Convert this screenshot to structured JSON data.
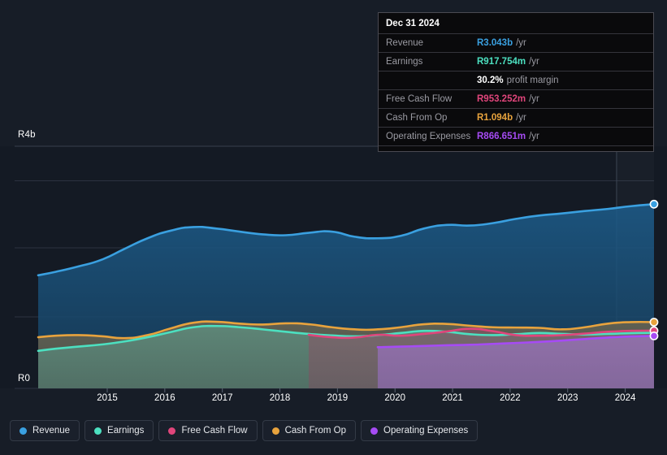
{
  "theme": {
    "background": "#171d27",
    "plot_background": "#141a24",
    "gridline": "#2b3240"
  },
  "tooltip": {
    "date": "Dec 31 2024",
    "rows": [
      {
        "name": "Revenue",
        "value": "R3.043b",
        "unit": "/yr",
        "color": "#3aa0e0"
      },
      {
        "name": "Earnings",
        "value": "R917.754m",
        "unit": "/yr",
        "color": "#4ce0c0"
      },
      {
        "name": "",
        "value": "30.2%",
        "unit": "",
        "sub": "profit margin",
        "color": "#ffffff"
      },
      {
        "name": "Free Cash Flow",
        "value": "R953.252m",
        "unit": "/yr",
        "color": "#e0457b"
      },
      {
        "name": "Cash From Op",
        "value": "R1.094b",
        "unit": "/yr",
        "color": "#e8a33d"
      },
      {
        "name": "Operating Expenses",
        "value": "R866.651m",
        "unit": "/yr",
        "color": "#a64bf4"
      }
    ]
  },
  "legend": {
    "items": [
      {
        "label": "Revenue",
        "color": "#3aa0e0"
      },
      {
        "label": "Earnings",
        "color": "#4ce0c0"
      },
      {
        "label": "Free Cash Flow",
        "color": "#e0457b"
      },
      {
        "label": "Cash From Op",
        "color": "#e8a33d"
      },
      {
        "label": "Operating Expenses",
        "color": "#a64bf4"
      }
    ]
  },
  "chart_data": {
    "type": "area",
    "title": "",
    "xlabel": "",
    "ylabel": "",
    "currency": "R",
    "ylim": [
      0,
      4000000000
    ],
    "y_ticks": [
      {
        "label": "R0",
        "value": 0
      },
      {
        "label": "R4b",
        "value": 4000000000
      }
    ],
    "grid": true,
    "legend_position": "bottom",
    "x_ticks": [
      "2015",
      "2016",
      "2017",
      "2018",
      "2019",
      "2020",
      "2021",
      "2022",
      "2023",
      "2024"
    ],
    "x": [
      2014.3,
      2014.6,
      2015.0,
      2015.4,
      2015.8,
      2016.2,
      2016.6,
      2017.0,
      2017.4,
      2017.8,
      2018.2,
      2018.6,
      2019.0,
      2019.4,
      2019.8,
      2020.2,
      2020.6,
      2021.0,
      2021.4,
      2021.8,
      2022.2,
      2022.6,
      2023.0,
      2023.4,
      2023.8,
      2024.2,
      2024.6,
      2025.0
    ],
    "series": [
      {
        "name": "Revenue",
        "color": "#3aa0e0",
        "values": [
          1.868,
          1.925,
          2.015,
          2.125,
          2.305,
          2.48,
          2.605,
          2.665,
          2.64,
          2.59,
          2.545,
          2.53,
          2.57,
          2.59,
          2.505,
          2.48,
          2.52,
          2.64,
          2.7,
          2.69,
          2.73,
          2.8,
          2.855,
          2.89,
          2.93,
          2.965,
          3.01,
          3.043
        ],
        "unit": "R (billions)"
      },
      {
        "name": "Cash From Op",
        "color": "#e8a33d",
        "values": [
          0.845,
          0.87,
          0.88,
          0.862,
          0.83,
          0.88,
          0.99,
          1.085,
          1.1,
          1.07,
          1.055,
          1.075,
          1.06,
          1.01,
          0.975,
          0.975,
          1.01,
          1.06,
          1.065,
          1.035,
          1.01,
          1.005,
          1.0,
          0.975,
          1.01,
          1.07,
          1.095,
          1.094
        ],
        "unit": "R (billions)"
      },
      {
        "name": "Earnings",
        "color": "#4ce0c0",
        "values": [
          0.62,
          0.655,
          0.69,
          0.725,
          0.775,
          0.845,
          0.93,
          1.01,
          1.03,
          1.01,
          0.975,
          0.935,
          0.9,
          0.875,
          0.86,
          0.88,
          0.915,
          0.95,
          0.935,
          0.895,
          0.88,
          0.895,
          0.915,
          0.9,
          0.89,
          0.9,
          0.912,
          0.918
        ],
        "unit": "R (billions)"
      },
      {
        "name": "Free Cash Flow",
        "color": "#e0457b",
        "start_index": 12,
        "values": [
          null,
          null,
          null,
          null,
          null,
          null,
          null,
          null,
          null,
          null,
          null,
          null,
          0.885,
          0.845,
          0.84,
          0.885,
          0.87,
          0.9,
          0.94,
          0.985,
          0.945,
          0.88,
          0.87,
          0.88,
          0.905,
          0.935,
          0.95,
          0.953
        ],
        "unit": "R (billions)"
      },
      {
        "name": "Operating Expenses",
        "color": "#a64bf4",
        "start_index": 15,
        "values": [
          null,
          null,
          null,
          null,
          null,
          null,
          null,
          null,
          null,
          null,
          null,
          null,
          null,
          null,
          null,
          0.68,
          0.69,
          0.7,
          0.712,
          0.72,
          0.735,
          0.75,
          0.768,
          0.79,
          0.815,
          0.84,
          0.858,
          0.867
        ],
        "unit": "R (billions)"
      }
    ],
    "forecast_divider_x": 2024.35,
    "end_markers": [
      {
        "series": "Revenue",
        "value": 3.043
      },
      {
        "series": "Cash From Op",
        "value": 1.094
      },
      {
        "series": "Free Cash Flow",
        "value": 0.953
      },
      {
        "series": "Operating Expenses",
        "value": 0.867
      }
    ]
  }
}
